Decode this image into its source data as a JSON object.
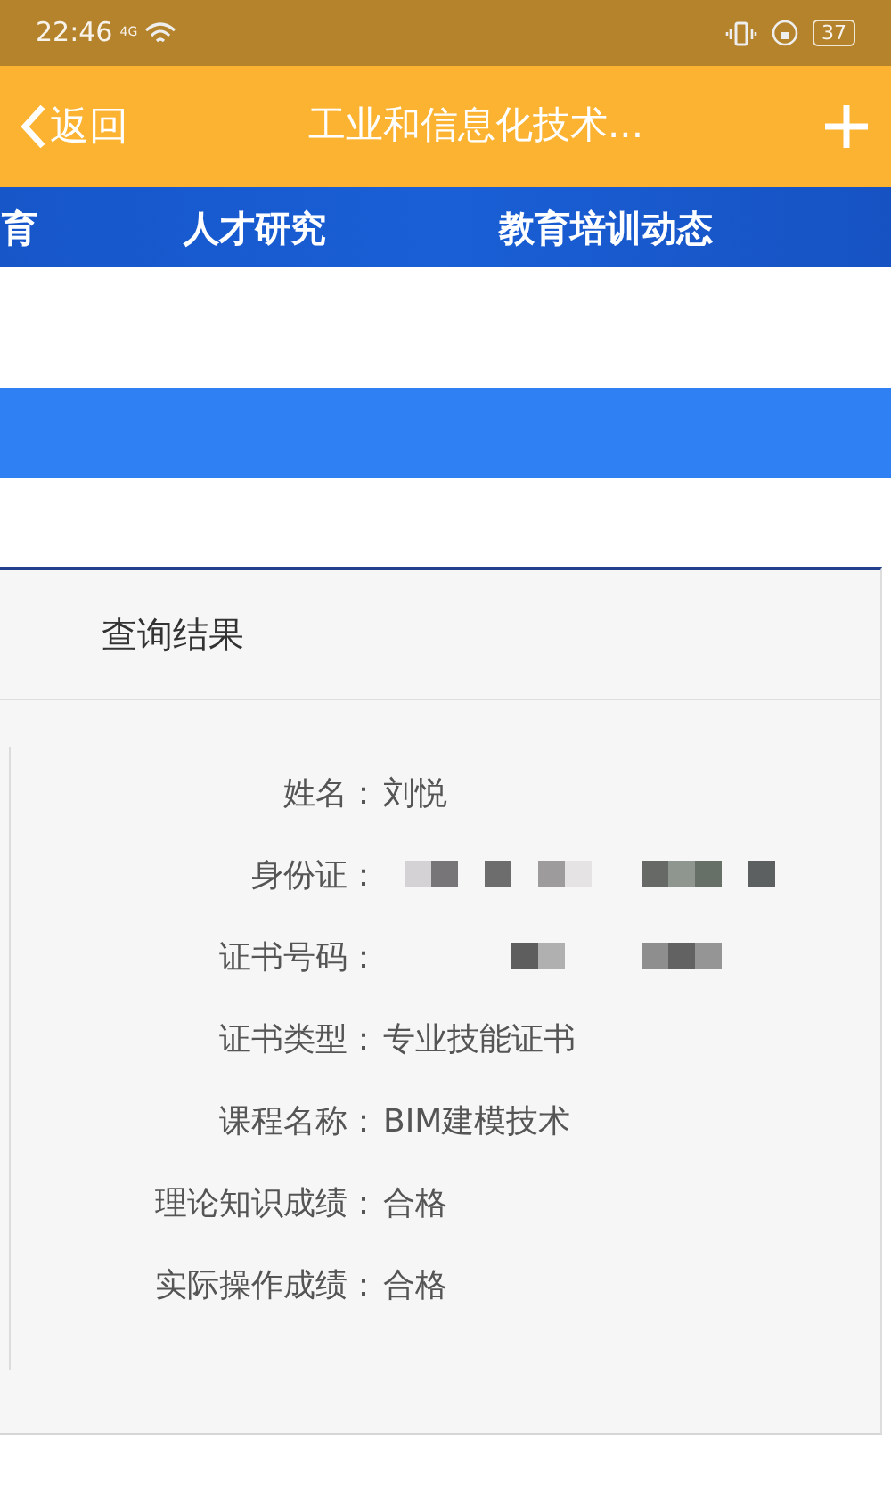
{
  "status_bar": {
    "time": "22:46",
    "network": "4G",
    "battery": "37"
  },
  "header": {
    "back_label": "返回",
    "title": "工业和信息化技术..."
  },
  "nav": {
    "items": [
      {
        "label": "育"
      },
      {
        "label": "人才研究"
      },
      {
        "label": "教育培训动态"
      }
    ]
  },
  "result": {
    "title": "查询结果",
    "fields": [
      {
        "label": "姓名：",
        "kind": "text",
        "value": "刘悦"
      },
      {
        "label": "身份证：",
        "kind": "redacted"
      },
      {
        "label": "证书号码：",
        "kind": "redacted"
      },
      {
        "label": "证书类型：",
        "kind": "text",
        "value": "专业技能证书"
      },
      {
        "label": "课程名称：",
        "kind": "text",
        "value": "BIM建模技术"
      },
      {
        "label": "理论知识成绩：",
        "kind": "text",
        "value": "合格"
      },
      {
        "label": "实际操作成绩：",
        "kind": "text",
        "value": "合格"
      }
    ]
  }
}
